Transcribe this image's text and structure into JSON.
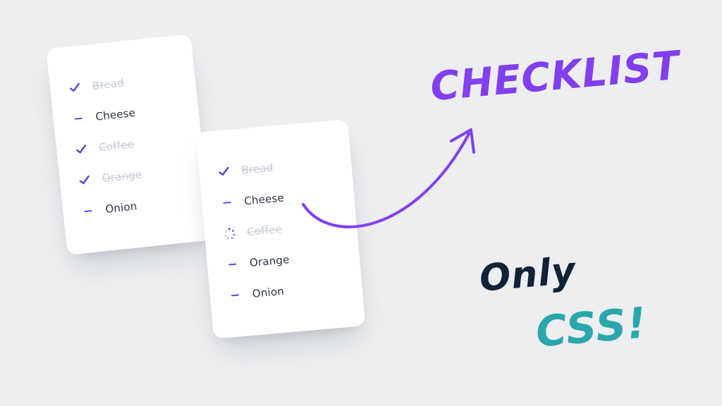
{
  "titles": {
    "checklist": "CHECKLIST",
    "only": "Only",
    "css": "CSS!"
  },
  "card_a": {
    "items": [
      {
        "label": "Bread",
        "state": "checked"
      },
      {
        "label": "Cheese",
        "state": "unchecked"
      },
      {
        "label": "Coffee",
        "state": "checked"
      },
      {
        "label": "Orange",
        "state": "checked"
      },
      {
        "label": "Onion",
        "state": "unchecked"
      }
    ]
  },
  "card_b": {
    "items": [
      {
        "label": "Bread",
        "state": "checked"
      },
      {
        "label": "Cheese",
        "state": "unchecked"
      },
      {
        "label": "Coffee",
        "state": "loading"
      },
      {
        "label": "Orange",
        "state": "unchecked"
      },
      {
        "label": "Onion",
        "state": "unchecked"
      }
    ]
  },
  "colors": {
    "accent_purple": "#823ff0",
    "check_indigo": "#5b4bdb",
    "dark_navy": "#0f2236",
    "teal": "#2aa7ad",
    "bg": "#eceef0"
  }
}
